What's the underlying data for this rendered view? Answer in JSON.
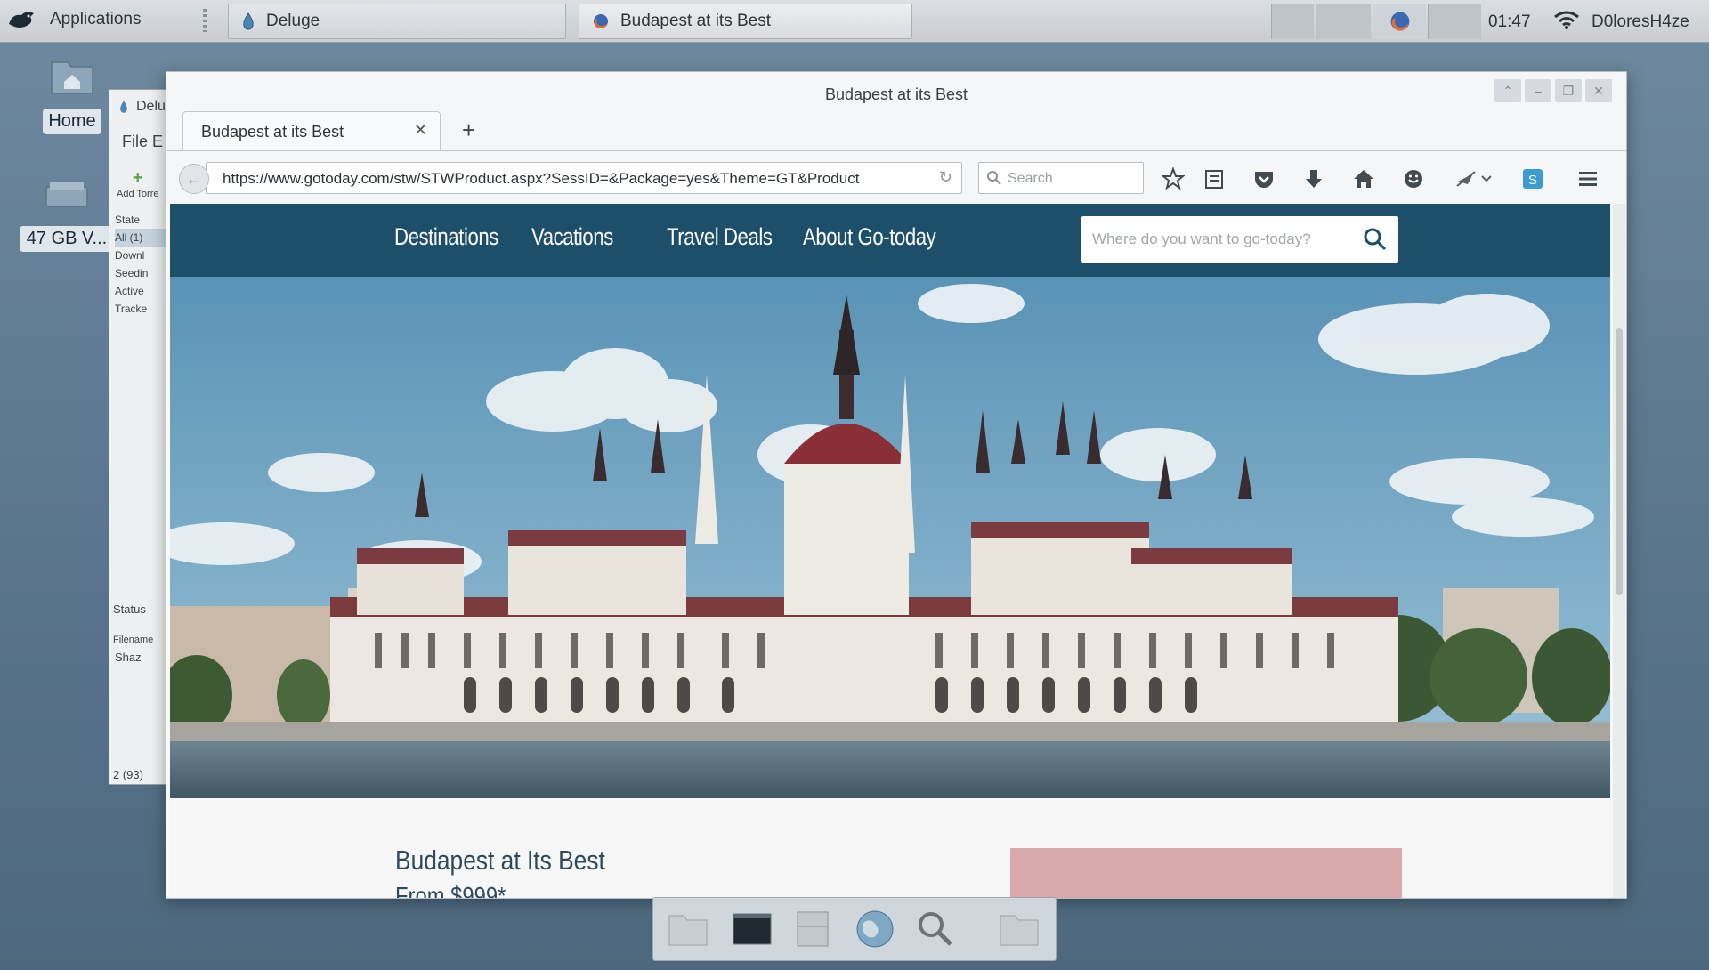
{
  "top_panel": {
    "applications_label": "Applications",
    "tasks": [
      {
        "label": "Deluge"
      },
      {
        "label": "Budapest at its Best"
      }
    ],
    "clock": "01:47",
    "username": "D0loresH4ze"
  },
  "desktop": {
    "icons": [
      {
        "label": "Home",
        "icon": "home-folder-icon"
      },
      {
        "label": "47 GB V...",
        "icon": "drive-icon"
      }
    ]
  },
  "deluge": {
    "title": "Delu",
    "menu": "File  E",
    "add_label": "Add Torre",
    "tree": [
      "State",
      "All (1)",
      "Downl",
      "Seedin",
      "Active",
      "Tracke"
    ],
    "status": "Status",
    "filename_header": "Filename",
    "file_item": "Shaz",
    "count": "2 (93)"
  },
  "browser": {
    "window_title": "Budapest at its Best",
    "tab_label": "Budapest at its Best",
    "url": "https://www.gotoday.com/stw/STWProduct.aspx?SessID=&Package=yes&Theme=GT&Product",
    "search_placeholder": "Search"
  },
  "site": {
    "nav": [
      "Destinations",
      "Vacations",
      "Travel Deals",
      "About Go-today"
    ],
    "search_placeholder": "Where do you want to go-today?",
    "heading": "Budapest at Its Best",
    "price_line": "From $999*"
  },
  "colors": {
    "site_nav": "#1d4f6a",
    "accent_pink": "#d9a8ab",
    "desktop_bg": "#5f7b92"
  }
}
